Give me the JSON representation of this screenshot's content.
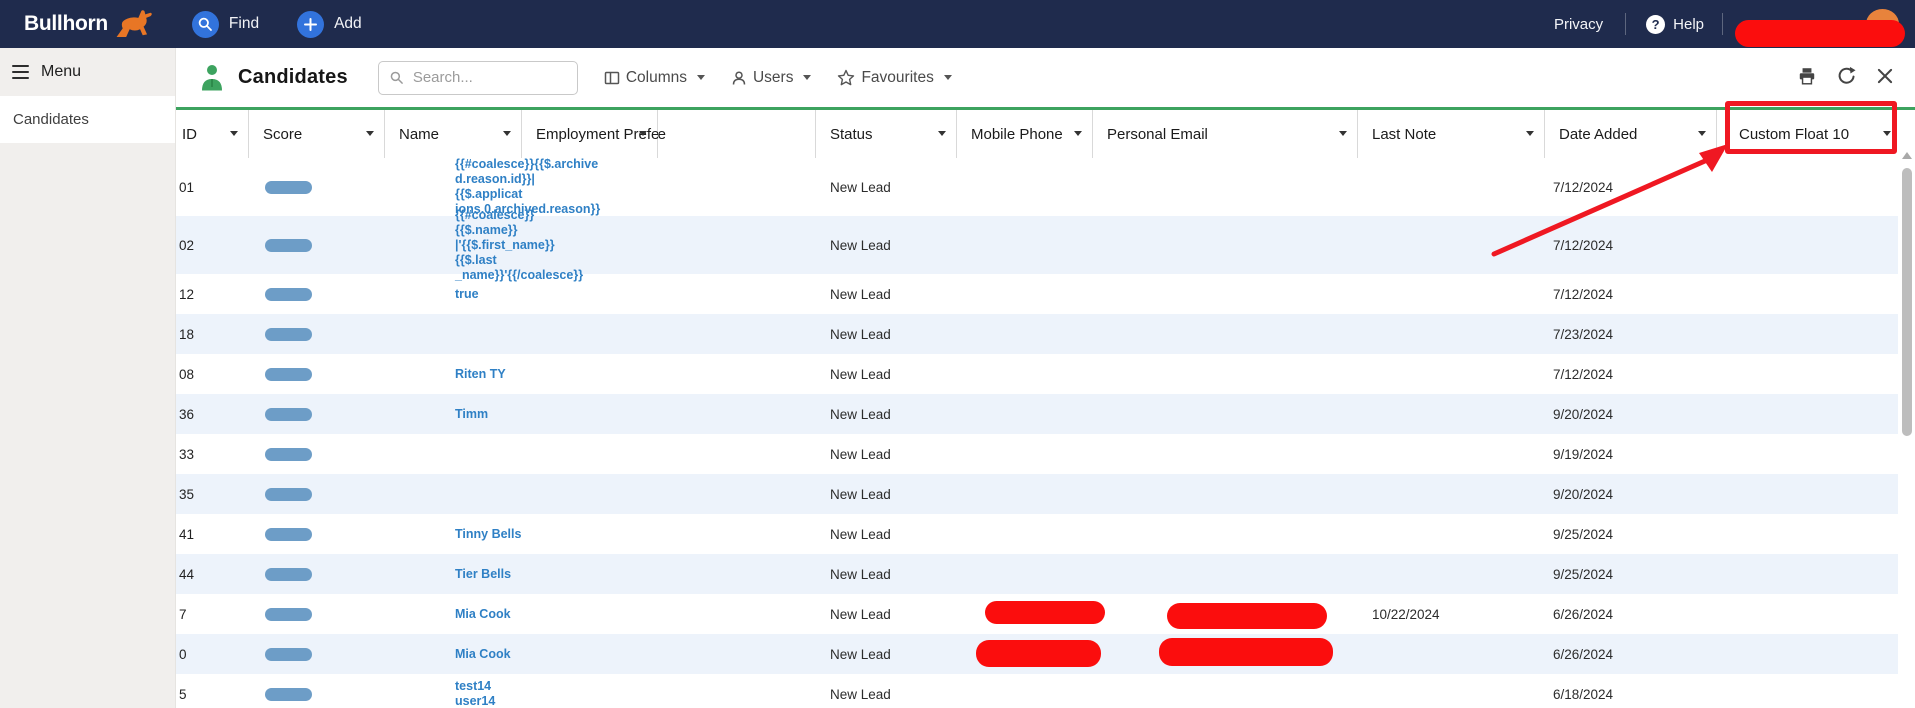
{
  "navbar": {
    "brand": "Bullhorn",
    "find_label": "Find",
    "add_label": "Add",
    "privacy_label": "Privacy",
    "help_label": "Help"
  },
  "sidebar": {
    "menu_label": "Menu",
    "items": [
      {
        "label": "Candidates"
      }
    ]
  },
  "toolbar": {
    "title": "Candidates",
    "search_placeholder": "Search...",
    "columns_label": "Columns",
    "users_label": "Users",
    "favourites_label": "Favourites"
  },
  "table": {
    "columns": [
      {
        "key": "id",
        "label": "ID",
        "caret": true
      },
      {
        "key": "score",
        "label": "Score",
        "caret": true
      },
      {
        "key": "name",
        "label": "Name",
        "caret": true
      },
      {
        "key": "employment",
        "label": "Employment Prefer",
        "caret": true,
        "clipped_tail": "e"
      },
      {
        "key": "extra",
        "label": "",
        "caret": false
      },
      {
        "key": "status",
        "label": "Status",
        "caret": true
      },
      {
        "key": "mobile",
        "label": "Mobile Phone",
        "caret": true
      },
      {
        "key": "email",
        "label": "Personal Email",
        "caret": true
      },
      {
        "key": "last_note",
        "label": "Last Note",
        "caret": true
      },
      {
        "key": "date_added",
        "label": "Date Added",
        "caret": true
      },
      {
        "key": "custom_float",
        "label": "Custom Float 10",
        "caret": true
      }
    ],
    "rows": [
      {
        "id": "01",
        "score": true,
        "name": "{{#coalesce}}{{$.archive\nd.reason.id}}|{{$.applicat\nions.0.archived.reason}}",
        "status": "New Lead",
        "last_note": "",
        "date_added": "7/12/2024",
        "tall": true
      },
      {
        "id": "02",
        "score": true,
        "name": "{{#coalesce}}{{$.name}}\n|'{{$.first_name}} {{$.last\n_name}}'{{/coalesce}}",
        "status": "New Lead",
        "last_note": "",
        "date_added": "7/12/2024",
        "tall": true
      },
      {
        "id": "12",
        "score": true,
        "name": "true",
        "status": "New Lead",
        "last_note": "",
        "date_added": "7/12/2024"
      },
      {
        "id": "18",
        "score": true,
        "name": "",
        "status": "New Lead",
        "last_note": "",
        "date_added": "7/23/2024"
      },
      {
        "id": "08",
        "score": true,
        "name": "Riten TY",
        "status": "New Lead",
        "last_note": "",
        "date_added": "7/12/2024"
      },
      {
        "id": "36",
        "score": true,
        "name": "Timm",
        "status": "New Lead",
        "last_note": "",
        "date_added": "9/20/2024"
      },
      {
        "id": "33",
        "score": true,
        "name": "",
        "status": "New Lead",
        "last_note": "",
        "date_added": "9/19/2024"
      },
      {
        "id": "35",
        "score": true,
        "name": "",
        "status": "New Lead",
        "last_note": "",
        "date_added": "9/20/2024"
      },
      {
        "id": "41",
        "score": true,
        "name": "Tinny Bells",
        "status": "New Lead",
        "last_note": "",
        "date_added": "9/25/2024"
      },
      {
        "id": "44",
        "score": true,
        "name": "Tier Bells",
        "status": "New Lead",
        "last_note": "",
        "date_added": "9/25/2024"
      },
      {
        "id": "7",
        "score": true,
        "name": "Mia Cook",
        "status": "New Lead",
        "mobile_redacted": true,
        "email_redacted": true,
        "last_note": "10/22/2024",
        "date_added": "6/26/2024"
      },
      {
        "id": "0",
        "score": true,
        "name": "Mia Cook",
        "status": "New Lead",
        "mobile_redacted": true,
        "email_redacted": true,
        "last_note": "",
        "date_added": "6/26/2024"
      },
      {
        "id": "5",
        "score": true,
        "name": "test14 user14",
        "status": "New Lead",
        "last_note": "",
        "date_added": "6/18/2024"
      }
    ]
  },
  "annotations": {
    "highlighted_column": "Custom Float 10",
    "redacted_fields": [
      "user-menu",
      "mobile-phone",
      "personal-email"
    ]
  },
  "colors": {
    "navy": "#1f2b4d",
    "green": "#3da35f",
    "blue_button": "#3273dc",
    "link_blue": "#2f80c5",
    "pill_blue": "#6d9dc7",
    "stripe_blue": "#edf3fb",
    "annotation_red": "#f11418"
  }
}
